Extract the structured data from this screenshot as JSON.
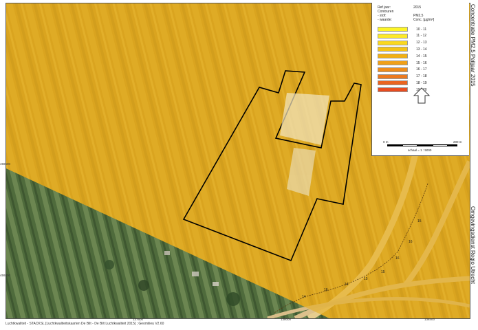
{
  "map": {
    "title": "Concentratie PM2,5 Peiljaar 2015",
    "organization": "Omgevingsdienst Regio Utrecht",
    "overlay_color": "#e8ad16",
    "contour_color": "#000000",
    "contour_labels": [
      "15",
      "16",
      "16",
      "15",
      "15",
      "14",
      "16",
      "14"
    ]
  },
  "legend": {
    "ref_label": "Ref jaar:",
    "ref_value": "2015",
    "contouren_label": "Contouren",
    "stof_label": "- stof:",
    "stof_value": "PM2,5",
    "waarde_label": "- waarde:",
    "waarde_value": "Conc. [µg/m³]",
    "classes": [
      {
        "label": "10 - 11",
        "color": "#fdf526"
      },
      {
        "label": "11 - 12",
        "color": "#fde928"
      },
      {
        "label": "12 - 13",
        "color": "#fbd81f"
      },
      {
        "label": "13 - 14",
        "color": "#f5c417"
      },
      {
        "label": "14 - 15",
        "color": "#f2b012"
      },
      {
        "label": "15 - 16",
        "color": "#f0a018"
      },
      {
        "label": "16 - 17",
        "color": "#ef8d1c"
      },
      {
        "label": "17 - 18",
        "color": "#ec7a1f"
      },
      {
        "label": "18 - 19",
        "color": "#ea6420"
      },
      {
        "label": "19 - 20",
        "color": "#e84d20"
      }
    ]
  },
  "scale": {
    "left_label": "0 m",
    "right_label": "200 m",
    "ratio_label": "schaal = 1 : 5000"
  },
  "axes": {
    "y_ticks": [
      "459600",
      "459200"
    ],
    "x_ticks": [
      "137600",
      "138000",
      "138400"
    ]
  },
  "footer": {
    "source": "Luchtkwaliteit - STACKSL [Luchtkwaliteitskaarten De Bilt - De Bilt Luchtkwaliteit 2015] ; Geomilieu V2.60"
  }
}
